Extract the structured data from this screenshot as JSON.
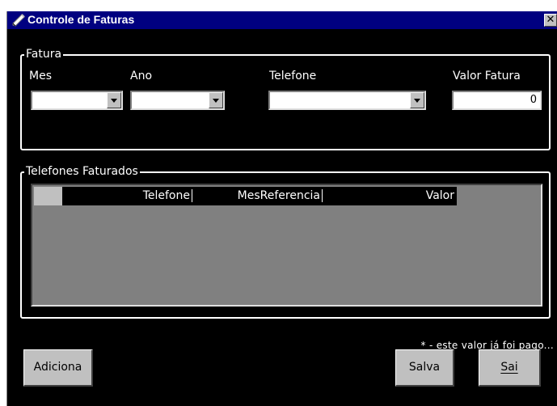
{
  "window": {
    "title": "Controle de Faturas",
    "close_glyph": "✕"
  },
  "fatura": {
    "legend": "Fatura",
    "mes_label": "Mes",
    "ano_label": "Ano",
    "telefone_label": "Telefone",
    "valor_label": "Valor Fatura",
    "mes_value": "",
    "ano_value": "",
    "telefone_value": "",
    "valor_value": "0"
  },
  "telefones": {
    "legend": "Telefones Faturados",
    "columns": [
      "Telefone",
      "MesReferencia",
      "Valor"
    ],
    "rows": []
  },
  "note": "* - este valor já foi pago...",
  "buttons": {
    "adiciona": "Adiciona",
    "salva": "Salva",
    "sai": "Sai"
  },
  "colors": {
    "titlebar": "#000080",
    "window_bg": "#000000",
    "grid_bg": "#808080"
  },
  "icons": {
    "title_icon": "pencil-icon",
    "close": "close-icon",
    "combo_arrow": "chevron-down-icon"
  }
}
